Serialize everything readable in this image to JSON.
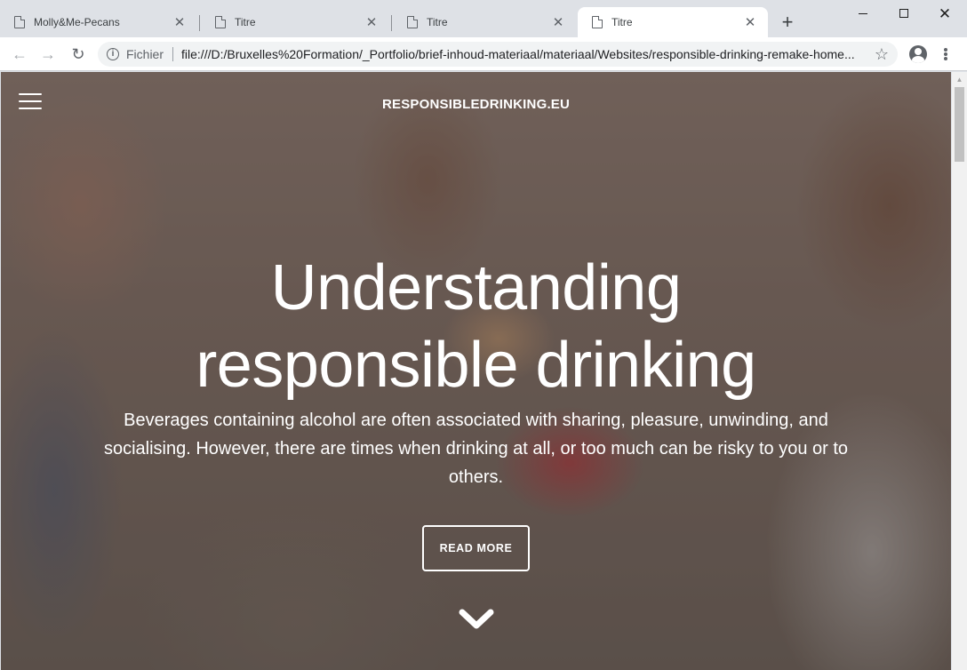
{
  "browser": {
    "tabs": [
      {
        "title": "Molly&Me-Pecans",
        "active": false
      },
      {
        "title": "Titre",
        "active": false
      },
      {
        "title": "Titre",
        "active": false
      },
      {
        "title": "Titre",
        "active": true
      }
    ],
    "new_tab": "+",
    "address": {
      "scheme_label": "Fichier",
      "url": "file:///D:/Bruxelles%20Formation/_Portfolio/brief-inhoud-materiaal/materiaal/Websites/responsible-drinking-remake-home..."
    }
  },
  "page": {
    "brand": "RESPONSIBLEDRINKING.EU",
    "headline_line1": "Understanding",
    "headline_line2": "responsible drinking",
    "lede": "Beverages containing alcohol are often associated with sharing, pleasure, unwinding, and socialising. However, there are times when drinking at all, or too much can be risky to you or to others.",
    "cta_label": "READ MORE"
  },
  "colors": {
    "accent": "#ffffff",
    "chrome_bg": "#dee1e6"
  },
  "icons": [
    "document-icon",
    "close-icon",
    "back-arrow-icon",
    "forward-arrow-icon",
    "reload-icon",
    "info-icon",
    "star-icon",
    "account-icon",
    "menu-icon",
    "hamburger-icon",
    "chevron-down-icon"
  ]
}
